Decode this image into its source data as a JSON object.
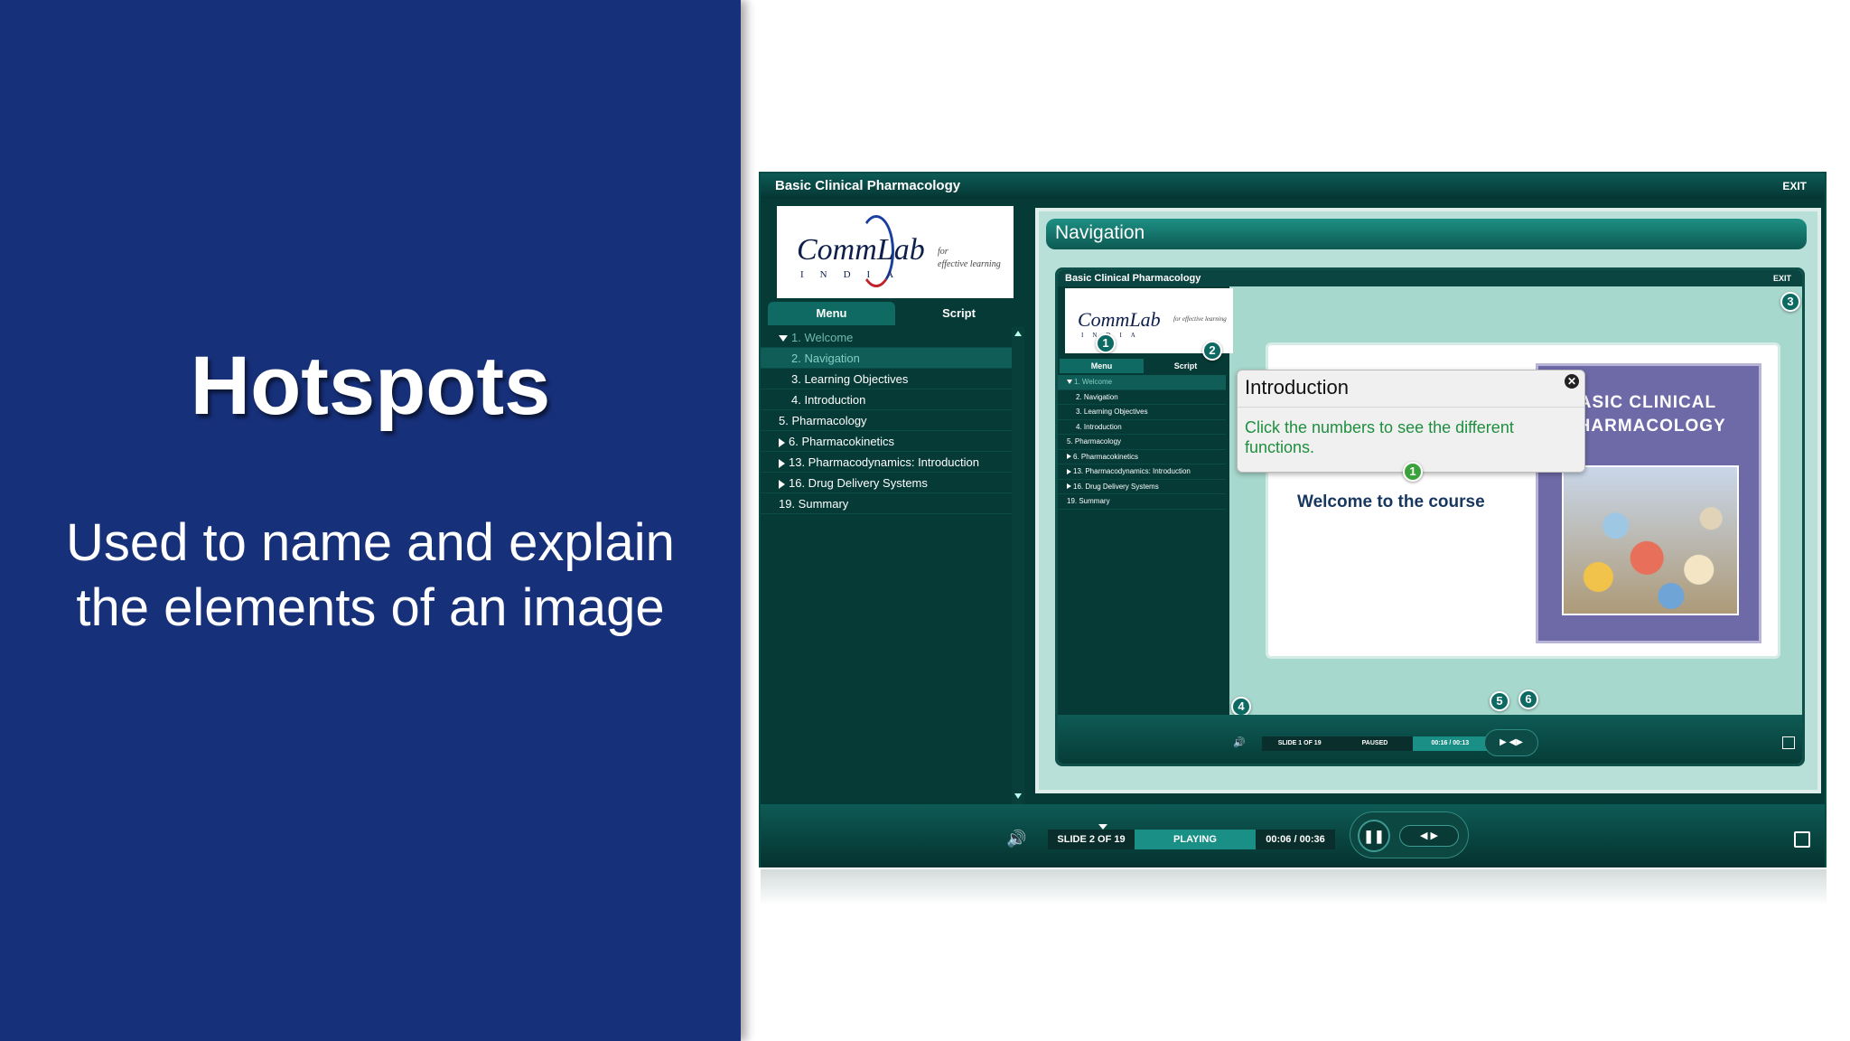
{
  "slide": {
    "title": "Hotspots",
    "subtitle": "Used to name and explain the elements of an image"
  },
  "app": {
    "title": "Basic Clinical Pharmacology",
    "exit": "EXIT",
    "logo": {
      "main": "CommLab",
      "india": "INDIA",
      "tagline_for": "for",
      "tagline": "effective learning"
    },
    "tabs": [
      "Menu",
      "Script"
    ],
    "menu": [
      {
        "label": "1. Welcome",
        "level": 0,
        "expand": "open",
        "state": "dim"
      },
      {
        "label": "2. Navigation",
        "level": 1,
        "expand": "",
        "state": "selected"
      },
      {
        "label": "3. Learning Objectives",
        "level": 1,
        "expand": "",
        "state": ""
      },
      {
        "label": "4. Introduction",
        "level": 1,
        "expand": "",
        "state": ""
      },
      {
        "label": "5. Pharmacology",
        "level": 0,
        "expand": "",
        "state": ""
      },
      {
        "label": "6. Pharmacokinetics",
        "level": 0,
        "expand": "closed",
        "state": ""
      },
      {
        "label": "13. Pharmacodynamics: Introduction",
        "level": 0,
        "expand": "closed",
        "state": ""
      },
      {
        "label": "16. Drug Delivery Systems",
        "level": 0,
        "expand": "closed",
        "state": ""
      },
      {
        "label": "19. Summary",
        "level": 0,
        "expand": "",
        "state": ""
      }
    ],
    "content_header": "Navigation",
    "player": {
      "slide_counter": "SLIDE 2 OF 19",
      "state": "PLAYING",
      "time": "00:06 / 00:36"
    }
  },
  "inner": {
    "title": "Basic Clinical Pharmacology",
    "exit": "EXIT",
    "logo": {
      "main": "CommLab",
      "india": "INDIA",
      "tagline_for": "for",
      "tagline": "effective learning"
    },
    "tabs": [
      "Menu",
      "Script"
    ],
    "menu": [
      {
        "label": "1. Welcome",
        "level": 0,
        "expand": "open",
        "state": "selected"
      },
      {
        "label": "2. Navigation",
        "level": 1,
        "expand": "",
        "state": ""
      },
      {
        "label": "3. Learning Objectives",
        "level": 1,
        "expand": "",
        "state": ""
      },
      {
        "label": "4. Introduction",
        "level": 1,
        "expand": "",
        "state": ""
      },
      {
        "label": "5. Pharmacology",
        "level": 0,
        "expand": "",
        "state": ""
      },
      {
        "label": "6. Pharmacokinetics",
        "level": 0,
        "expand": "closed",
        "state": ""
      },
      {
        "label": "13. Pharmacodynamics: Introduction",
        "level": 0,
        "expand": "closed",
        "state": ""
      },
      {
        "label": "16. Drug Delivery Systems",
        "level": 0,
        "expand": "closed",
        "state": ""
      },
      {
        "label": "19. Summary",
        "level": 0,
        "expand": "",
        "state": ""
      }
    ],
    "welcome": "Welcome to the course",
    "book_title_line1": "BASIC CLINICAL",
    "book_title_line2": "PHARMACOLOGY",
    "tooltip": {
      "title": "Introduction",
      "body": "Click the numbers to see the different functions.",
      "close": "✕"
    },
    "hotspots": [
      "1",
      "2",
      "3",
      "4",
      "5",
      "6"
    ],
    "player": {
      "slide_counter": "SLIDE 1 OF 19",
      "state": "PAUSED",
      "time": "00:16 / 00:13"
    }
  },
  "colors": {
    "slide_blue": "#17307a",
    "app_dark_teal": "#063a36",
    "accent_teal": "#1a8f85",
    "tooltip_green_text": "#1e8f3e"
  }
}
